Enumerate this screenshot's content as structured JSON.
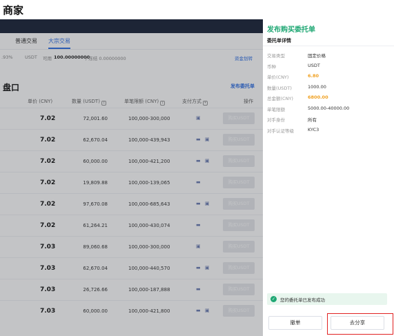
{
  "page_title": "商家",
  "tabs": [
    {
      "label": "普通交易"
    },
    {
      "label": "大宗交易"
    }
  ],
  "balance": {
    "pct": ".93%",
    "currency": "USDT",
    "avail_label": "可用",
    "avail_value": "100.00000000",
    "frozen": "/ 冻结 0.00000000",
    "transfer_link": "资金划转"
  },
  "market": {
    "title": "盘口",
    "publish_link": "发布委托单",
    "columns": {
      "price": "单价 (CNY)",
      "qty": "数量 (USDT)",
      "limit": "单笔限额 (CNY)",
      "pay": "支付方式",
      "action": "操作"
    },
    "rows": [
      {
        "price": "7.02",
        "qty": "72,001.60",
        "limit": "100,000-300,000",
        "pay": "▣",
        "buy": "购买USDT"
      },
      {
        "price": "7.02",
        "qty": "62,670.04",
        "limit": "100,000-439,943",
        "pay": "▬ ▣",
        "buy": "购买USDT"
      },
      {
        "price": "7.02",
        "qty": "60,000.00",
        "limit": "100,000-421,200",
        "pay": "▬ ▣",
        "buy": "购买USDT"
      },
      {
        "price": "7.02",
        "qty": "19,809.88",
        "limit": "100,000-139,065",
        "pay": "▬",
        "buy": "购买USDT"
      },
      {
        "price": "7.02",
        "qty": "97,670.08",
        "limit": "100,000-685,643",
        "pay": "▬ ▣",
        "buy": "购买USDT"
      },
      {
        "price": "7.02",
        "qty": "61,264.21",
        "limit": "100,000-430,074",
        "pay": "▬",
        "buy": "购买USDT"
      },
      {
        "price": "7.03",
        "qty": "89,060.68",
        "limit": "100,000-300,000",
        "pay": "▣",
        "buy": "购买USDT"
      },
      {
        "price": "7.03",
        "qty": "62,670.04",
        "limit": "100,000-440,570",
        "pay": "▬ ▣",
        "buy": "购买USDT"
      },
      {
        "price": "7.03",
        "qty": "26,726.66",
        "limit": "100,000-187,888",
        "pay": "▬",
        "buy": "购买USDT"
      },
      {
        "price": "7.03",
        "qty": "60,000.00",
        "limit": "100,000-421,800",
        "pay": "▬ ▣",
        "buy": "购买USDT"
      }
    ]
  },
  "panel": {
    "title": "发布购买委托单",
    "subtitle": "委托单详情",
    "details": [
      {
        "label": "交易类型",
        "value": "固定价格",
        "highlight": false
      },
      {
        "label": "币种",
        "value": "USDT",
        "highlight": false
      },
      {
        "label": "单价(CNY)",
        "value": "6.80",
        "highlight": true
      },
      {
        "label": "数量(USDT)",
        "value": "1000.00",
        "highlight": false
      },
      {
        "label": "总金额(CNY)",
        "value": "6800.00",
        "highlight": true
      },
      {
        "label": "单笔限额",
        "value": "5000.00-40000.00",
        "highlight": false
      },
      {
        "label": "对手身份",
        "value": "所有",
        "highlight": false
      },
      {
        "label": "对手认证等级",
        "value": "KYC3",
        "highlight": false
      }
    ],
    "toast": {
      "icon": "check-circle-icon",
      "text": "您的委托单已发布成功"
    },
    "revoke_label": "撤单",
    "share_label": "去分享"
  },
  "colors": {
    "accent_blue": "#2f6fe4",
    "success_green": "#1ea773",
    "highlight_orange": "#f0a020",
    "highlight_red": "#e02020"
  }
}
